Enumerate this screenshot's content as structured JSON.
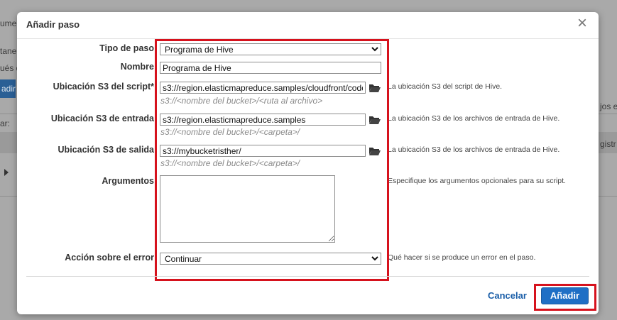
{
  "background": {
    "fragments": [
      "umen",
      "tane",
      "ués d",
      "ar:",
      "jos e",
      "gistr"
    ],
    "button_fragment": "adir"
  },
  "dialog": {
    "title": "Añadir paso",
    "close_symbol": "×",
    "fields": {
      "step_type": {
        "label": "Tipo de paso",
        "value": "Programa de Hive"
      },
      "name": {
        "label": "Nombre",
        "value": "Programa de Hive"
      },
      "script_location": {
        "label": "Ubicación S3 del script*",
        "value": "s3://region.elasticmapreduce.samples/cloudfront/code",
        "hint": "s3://<nombre del bucket>/<ruta al archivo>",
        "description": "La ubicación S3 del script de Hive."
      },
      "input_location": {
        "label": "Ubicación S3 de entrada",
        "value": "s3://region.elasticmapreduce.samples",
        "hint": "s3://<nombre del bucket>/<carpeta>/",
        "description": "La ubicación S3 de los archivos de entrada de Hive."
      },
      "output_location": {
        "label": "Ubicación S3 de salida",
        "value": "s3://mybucketristher/",
        "hint": "s3://<nombre del bucket>/<carpeta>/",
        "description": "La ubicación S3 de los archivos de entrada de Hive."
      },
      "arguments": {
        "label": "Argumentos",
        "value": "",
        "description": "Especifique los argumentos opcionales para su script."
      },
      "on_error": {
        "label": "Acción sobre el error",
        "value": "Continuar",
        "description": "Qué hacer si se produce un error en el paso."
      }
    },
    "buttons": {
      "cancel": "Cancelar",
      "add": "Añadir"
    }
  },
  "colors": {
    "highlight": "#d6121d",
    "primary": "#1f6fc5",
    "link": "#1a5ea8"
  }
}
